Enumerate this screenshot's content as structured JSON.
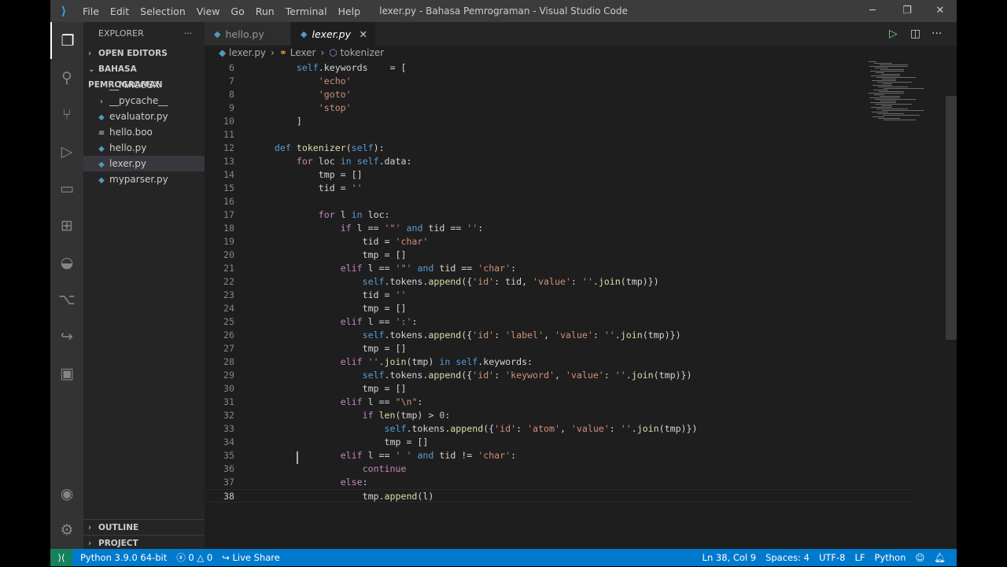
{
  "window": {
    "title": "lexer.py - Bahasa Pemrograman - Visual Studio Code",
    "menu": [
      "File",
      "Edit",
      "Selection",
      "View",
      "Go",
      "Run",
      "Terminal",
      "Help"
    ]
  },
  "sidebar": {
    "title": "EXPLORER",
    "open_editors": "OPEN EDITORS",
    "folder": "BAHASA PEMROGRAMAN",
    "items": [
      {
        "label": "__MACOSX",
        "kind": "folder"
      },
      {
        "label": "__pycache__",
        "kind": "folder"
      },
      {
        "label": "evaluator.py",
        "kind": "py"
      },
      {
        "label": "hello.boo",
        "kind": "txt"
      },
      {
        "label": "hello.py",
        "kind": "py"
      },
      {
        "label": "lexer.py",
        "kind": "py",
        "selected": true
      },
      {
        "label": "myparser.py",
        "kind": "py"
      }
    ],
    "outline": "OUTLINE",
    "project_components": "PROJECT COMPONENTS"
  },
  "tabs": [
    {
      "label": "hello.py",
      "active": false
    },
    {
      "label": "lexer.py",
      "active": true
    }
  ],
  "breadcrumb": [
    "lexer.py",
    "Lexer",
    "tokenizer"
  ],
  "code": {
    "cursor_line": 38,
    "lines": [
      {
        "n": 6,
        "text": "        self.keywords    = ["
      },
      {
        "n": 7,
        "text": "            'echo'"
      },
      {
        "n": 8,
        "text": "            'goto'"
      },
      {
        "n": 9,
        "text": "            'stop'"
      },
      {
        "n": 10,
        "text": "        ]"
      },
      {
        "n": 11,
        "text": ""
      },
      {
        "n": 12,
        "text": "    def tokenizer(self):"
      },
      {
        "n": 13,
        "text": "        for loc in self.data:"
      },
      {
        "n": 14,
        "text": "            tmp = []"
      },
      {
        "n": 15,
        "text": "            tid = ''"
      },
      {
        "n": 16,
        "text": ""
      },
      {
        "n": 17,
        "text": "            for l in loc:"
      },
      {
        "n": 18,
        "text": "                if l == '\"' and tid == '':"
      },
      {
        "n": 19,
        "text": "                    tid = 'char'"
      },
      {
        "n": 20,
        "text": "                    tmp = []"
      },
      {
        "n": 21,
        "text": "                elif l == '\"' and tid == 'char':"
      },
      {
        "n": 22,
        "text": "                    self.tokens.append({'id': tid, 'value': ''.join(tmp)})"
      },
      {
        "n": 23,
        "text": "                    tid = ''"
      },
      {
        "n": 24,
        "text": "                    tmp = []"
      },
      {
        "n": 25,
        "text": "                elif l == ':':"
      },
      {
        "n": 26,
        "text": "                    self.tokens.append({'id': 'label', 'value': ''.join(tmp)})"
      },
      {
        "n": 27,
        "text": "                    tmp = []"
      },
      {
        "n": 28,
        "text": "                elif ''.join(tmp) in self.keywords:"
      },
      {
        "n": 29,
        "text": "                    self.tokens.append({'id': 'keyword', 'value': ''.join(tmp)})"
      },
      {
        "n": 30,
        "text": "                    tmp = []"
      },
      {
        "n": 31,
        "text": "                elif l == \"\\n\":"
      },
      {
        "n": 32,
        "text": "                    if len(tmp) > 0:"
      },
      {
        "n": 33,
        "text": "                        self.tokens.append({'id': 'atom', 'value': ''.join(tmp)})"
      },
      {
        "n": 34,
        "text": "                        tmp = []"
      },
      {
        "n": 35,
        "text": "                elif l == ' ' and tid != 'char':"
      },
      {
        "n": 36,
        "text": "                    continue"
      },
      {
        "n": 37,
        "text": "                else:"
      },
      {
        "n": 38,
        "text": "                    tmp.append(l)"
      }
    ]
  },
  "status": {
    "python": "Python 3.9.0 64-bit",
    "errors": "0",
    "warnings": "0",
    "live_share": "Live Share",
    "position": "Ln 38, Col 9",
    "spaces": "Spaces: 4",
    "encoding": "UTF-8",
    "eol": "LF",
    "language": "Python",
    "accent": "#007acc"
  }
}
